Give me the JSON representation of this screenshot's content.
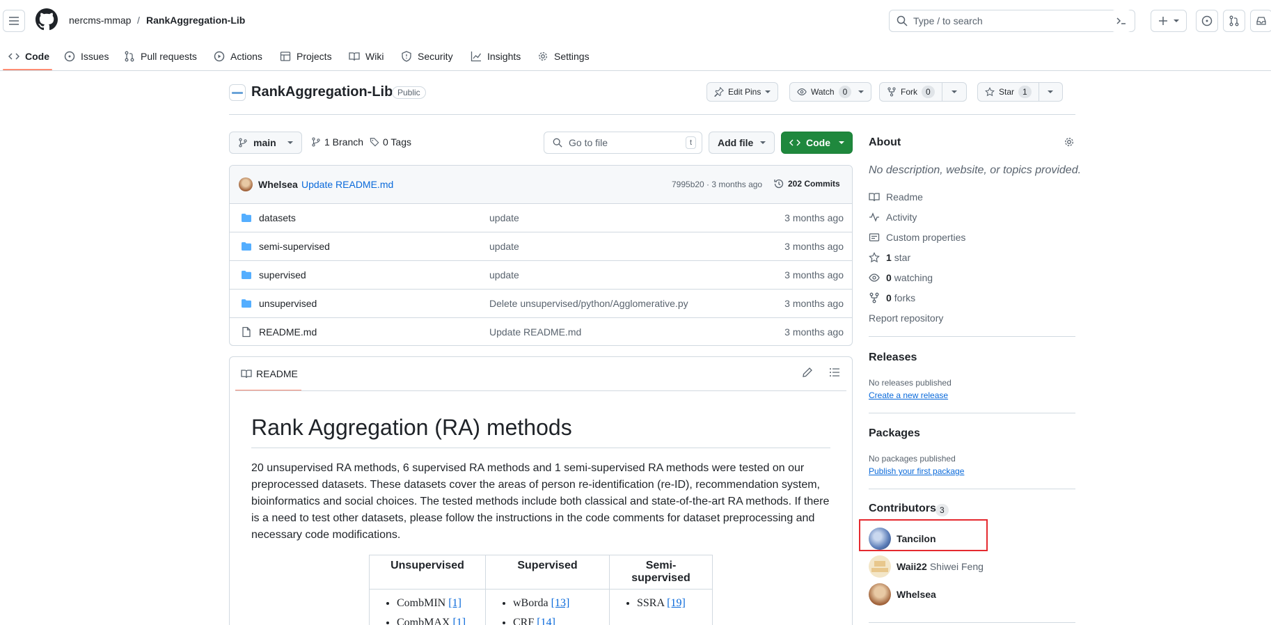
{
  "header": {
    "owner": "nercms-mmap",
    "separator": "/",
    "repo": "RankAggregation-Lib",
    "search_placeholder": "Type / to search"
  },
  "nav": {
    "tabs": [
      {
        "label": "Code",
        "icon": "code-icon"
      },
      {
        "label": "Issues",
        "icon": "issue-icon"
      },
      {
        "label": "Pull requests",
        "icon": "pull-request-icon"
      },
      {
        "label": "Actions",
        "icon": "play-icon"
      },
      {
        "label": "Projects",
        "icon": "table-icon"
      },
      {
        "label": "Wiki",
        "icon": "book-icon"
      },
      {
        "label": "Security",
        "icon": "shield-icon"
      },
      {
        "label": "Insights",
        "icon": "graph-icon"
      },
      {
        "label": "Settings",
        "icon": "gear-icon"
      }
    ]
  },
  "repo": {
    "name": "RankAggregation-Lib",
    "visibility": "Public",
    "edit_pins": "Edit Pins",
    "watch": "Watch",
    "watch_count": "0",
    "fork": "Fork",
    "fork_count": "0",
    "star": "Star",
    "star_count": "1"
  },
  "toolbar": {
    "branch": "main",
    "branches": "1 Branch",
    "tags": "0 Tags",
    "goto_placeholder": "Go to file",
    "goto_key": "t",
    "add_file": "Add file",
    "code": "Code"
  },
  "commit": {
    "author": "Whelsea",
    "message": "Update README.md",
    "meta": "7995b20 · 3 months ago",
    "commits": "202 Commits"
  },
  "files": [
    {
      "name": "datasets",
      "type": "folder",
      "message": "update",
      "age": "3 months ago"
    },
    {
      "name": "semi-supervised",
      "type": "folder",
      "message": "update",
      "age": "3 months ago"
    },
    {
      "name": "supervised",
      "type": "folder",
      "message": "update",
      "age": "3 months ago"
    },
    {
      "name": "unsupervised",
      "type": "folder",
      "message": "Delete unsupervised/python/Agglomerative.py",
      "age": "3 months ago"
    },
    {
      "name": "README.md",
      "type": "file",
      "message": "Update README.md",
      "age": "3 months ago"
    }
  ],
  "readme": {
    "tab_label": "README",
    "title": "Rank Aggregation (RA) methods",
    "paragraph_lines": [
      "20 unsupervised RA methods, 6 supervised RA methods and 1 semi-supervised RA methods were tested on our",
      "preprocessed datasets. These datasets cover the areas of person re-identification (re-ID), recommendation system,",
      "bioinformatics and social choices. The tested methods include both classical and state-of-the-art RA methods. If there",
      "is a need to test other datasets, please follow the instructions in the code comments for dataset preprocessing and",
      "necessary code modifications."
    ],
    "table": {
      "headers": [
        "Unsupervised",
        "Supervised",
        "Semi-supervised"
      ],
      "unsupervised": [
        {
          "name": "CombMIN",
          "ref": "[1]"
        },
        {
          "name": "CombMAX",
          "ref": "[1]"
        }
      ],
      "supervised": [
        {
          "name": "wBorda",
          "ref": "[13]"
        },
        {
          "name": "CRF",
          "ref": "[14]"
        }
      ],
      "semi": [
        {
          "name": "SSRA",
          "ref": "[19]"
        }
      ]
    }
  },
  "about": {
    "title": "About",
    "description": "No description, website, or topics provided.",
    "items": [
      {
        "label": "Readme",
        "icon": "book-icon"
      },
      {
        "label": "Activity",
        "icon": "pulse-icon"
      },
      {
        "label": "Custom properties",
        "icon": "note-icon"
      },
      {
        "count": "1",
        "label": "star",
        "icon": "star-icon"
      },
      {
        "count": "0",
        "label": "watching",
        "icon": "eye-icon"
      },
      {
        "count": "0",
        "label": "forks",
        "icon": "fork-icon"
      }
    ],
    "report": "Report repository"
  },
  "releases": {
    "title": "Releases",
    "none": "No releases published",
    "link": "Create a new release"
  },
  "packages": {
    "title": "Packages",
    "none": "No packages published",
    "link": "Publish your first package"
  },
  "contributors": {
    "title": "Contributors",
    "count": "3",
    "list": [
      {
        "login": "Tancilon",
        "name": ""
      },
      {
        "login": "Waii22",
        "name": "Shiwei Feng"
      },
      {
        "login": "Whelsea",
        "name": ""
      }
    ]
  },
  "colors": {
    "accent_orange": "#fd8c73",
    "green": "#1f883d",
    "link": "#0969da",
    "folder": "#54aeff",
    "highlight": "#e5292f"
  }
}
